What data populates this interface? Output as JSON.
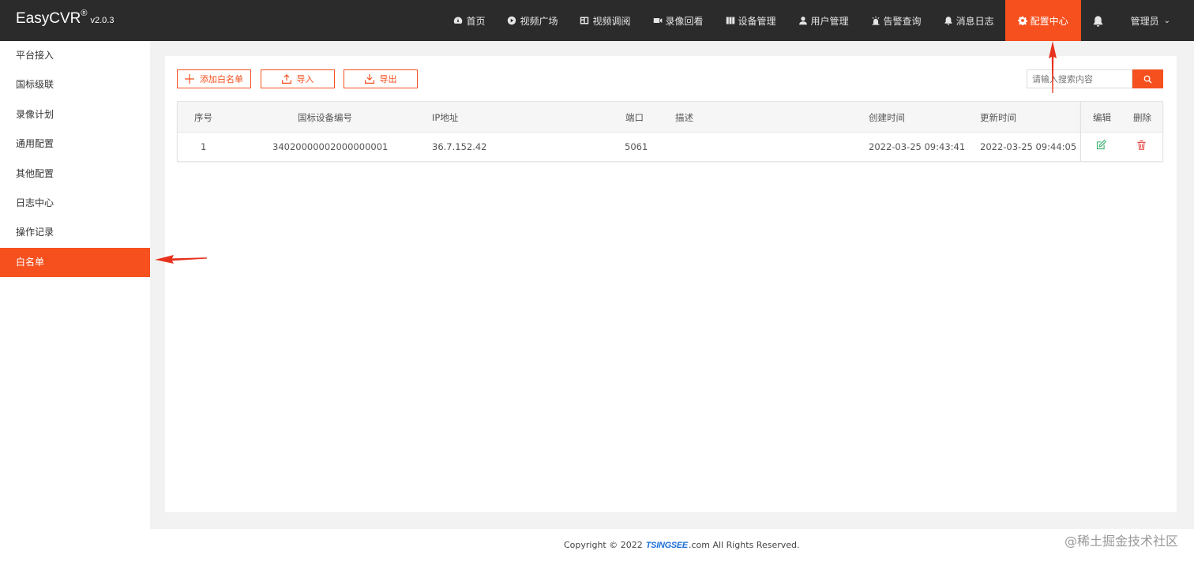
{
  "brand": {
    "name": "EasyCVR",
    "reg": "®",
    "version": "v2.0.3"
  },
  "nav": [
    {
      "label": "首页",
      "icon": "dashboard-icon"
    },
    {
      "label": "视频广场",
      "icon": "play-circle-icon"
    },
    {
      "label": "视频调阅",
      "icon": "video-grid-icon"
    },
    {
      "label": "录像回看",
      "icon": "video-camera-icon"
    },
    {
      "label": "设备管理",
      "icon": "device-columns-icon"
    },
    {
      "label": "用户管理",
      "icon": "user-icon"
    },
    {
      "label": "告警查询",
      "icon": "alarm-icon"
    },
    {
      "label": "消息日志",
      "icon": "bell-icon"
    },
    {
      "label": "配置中心",
      "icon": "gear-icon",
      "active": true
    }
  ],
  "user": {
    "label": "管理员",
    "chevron": "⌄"
  },
  "sidebar": {
    "items": [
      {
        "label": "平台接入"
      },
      {
        "label": "国标级联"
      },
      {
        "label": "录像计划"
      },
      {
        "label": "通用配置"
      },
      {
        "label": "其他配置"
      },
      {
        "label": "日志中心"
      },
      {
        "label": "操作记录"
      },
      {
        "label": "白名单",
        "active": true
      }
    ]
  },
  "toolbar": {
    "add_label": "添加白名单",
    "import_label": "导入",
    "export_label": "导出",
    "search_placeholder": "请输入搜索内容"
  },
  "table": {
    "headers": {
      "index": "序号",
      "device_id": "国标设备编号",
      "ip": "IP地址",
      "port": "端口",
      "desc": "描述",
      "created": "创建时间",
      "updated": "更新时间",
      "edit": "编辑",
      "delete": "删除"
    },
    "rows": [
      {
        "index": "1",
        "device_id": "34020000002000000001",
        "ip": "36.7.152.42",
        "port": "5061",
        "desc": "",
        "created": "2022-03-25 09:43:41",
        "updated": "2022-03-25 09:44:05"
      }
    ]
  },
  "footer": {
    "copyright_prefix": "Copyright © 2022",
    "logo": "TSINGSEE",
    "copyright_suffix": ".com All Rights Reserved."
  },
  "watermark": "@稀土掘金技术社区",
  "colors": {
    "accent": "#f5501e",
    "topbar": "#2b2b2b",
    "edit": "#3cb371",
    "delete": "#e53935",
    "arrow": "#e8321e"
  }
}
